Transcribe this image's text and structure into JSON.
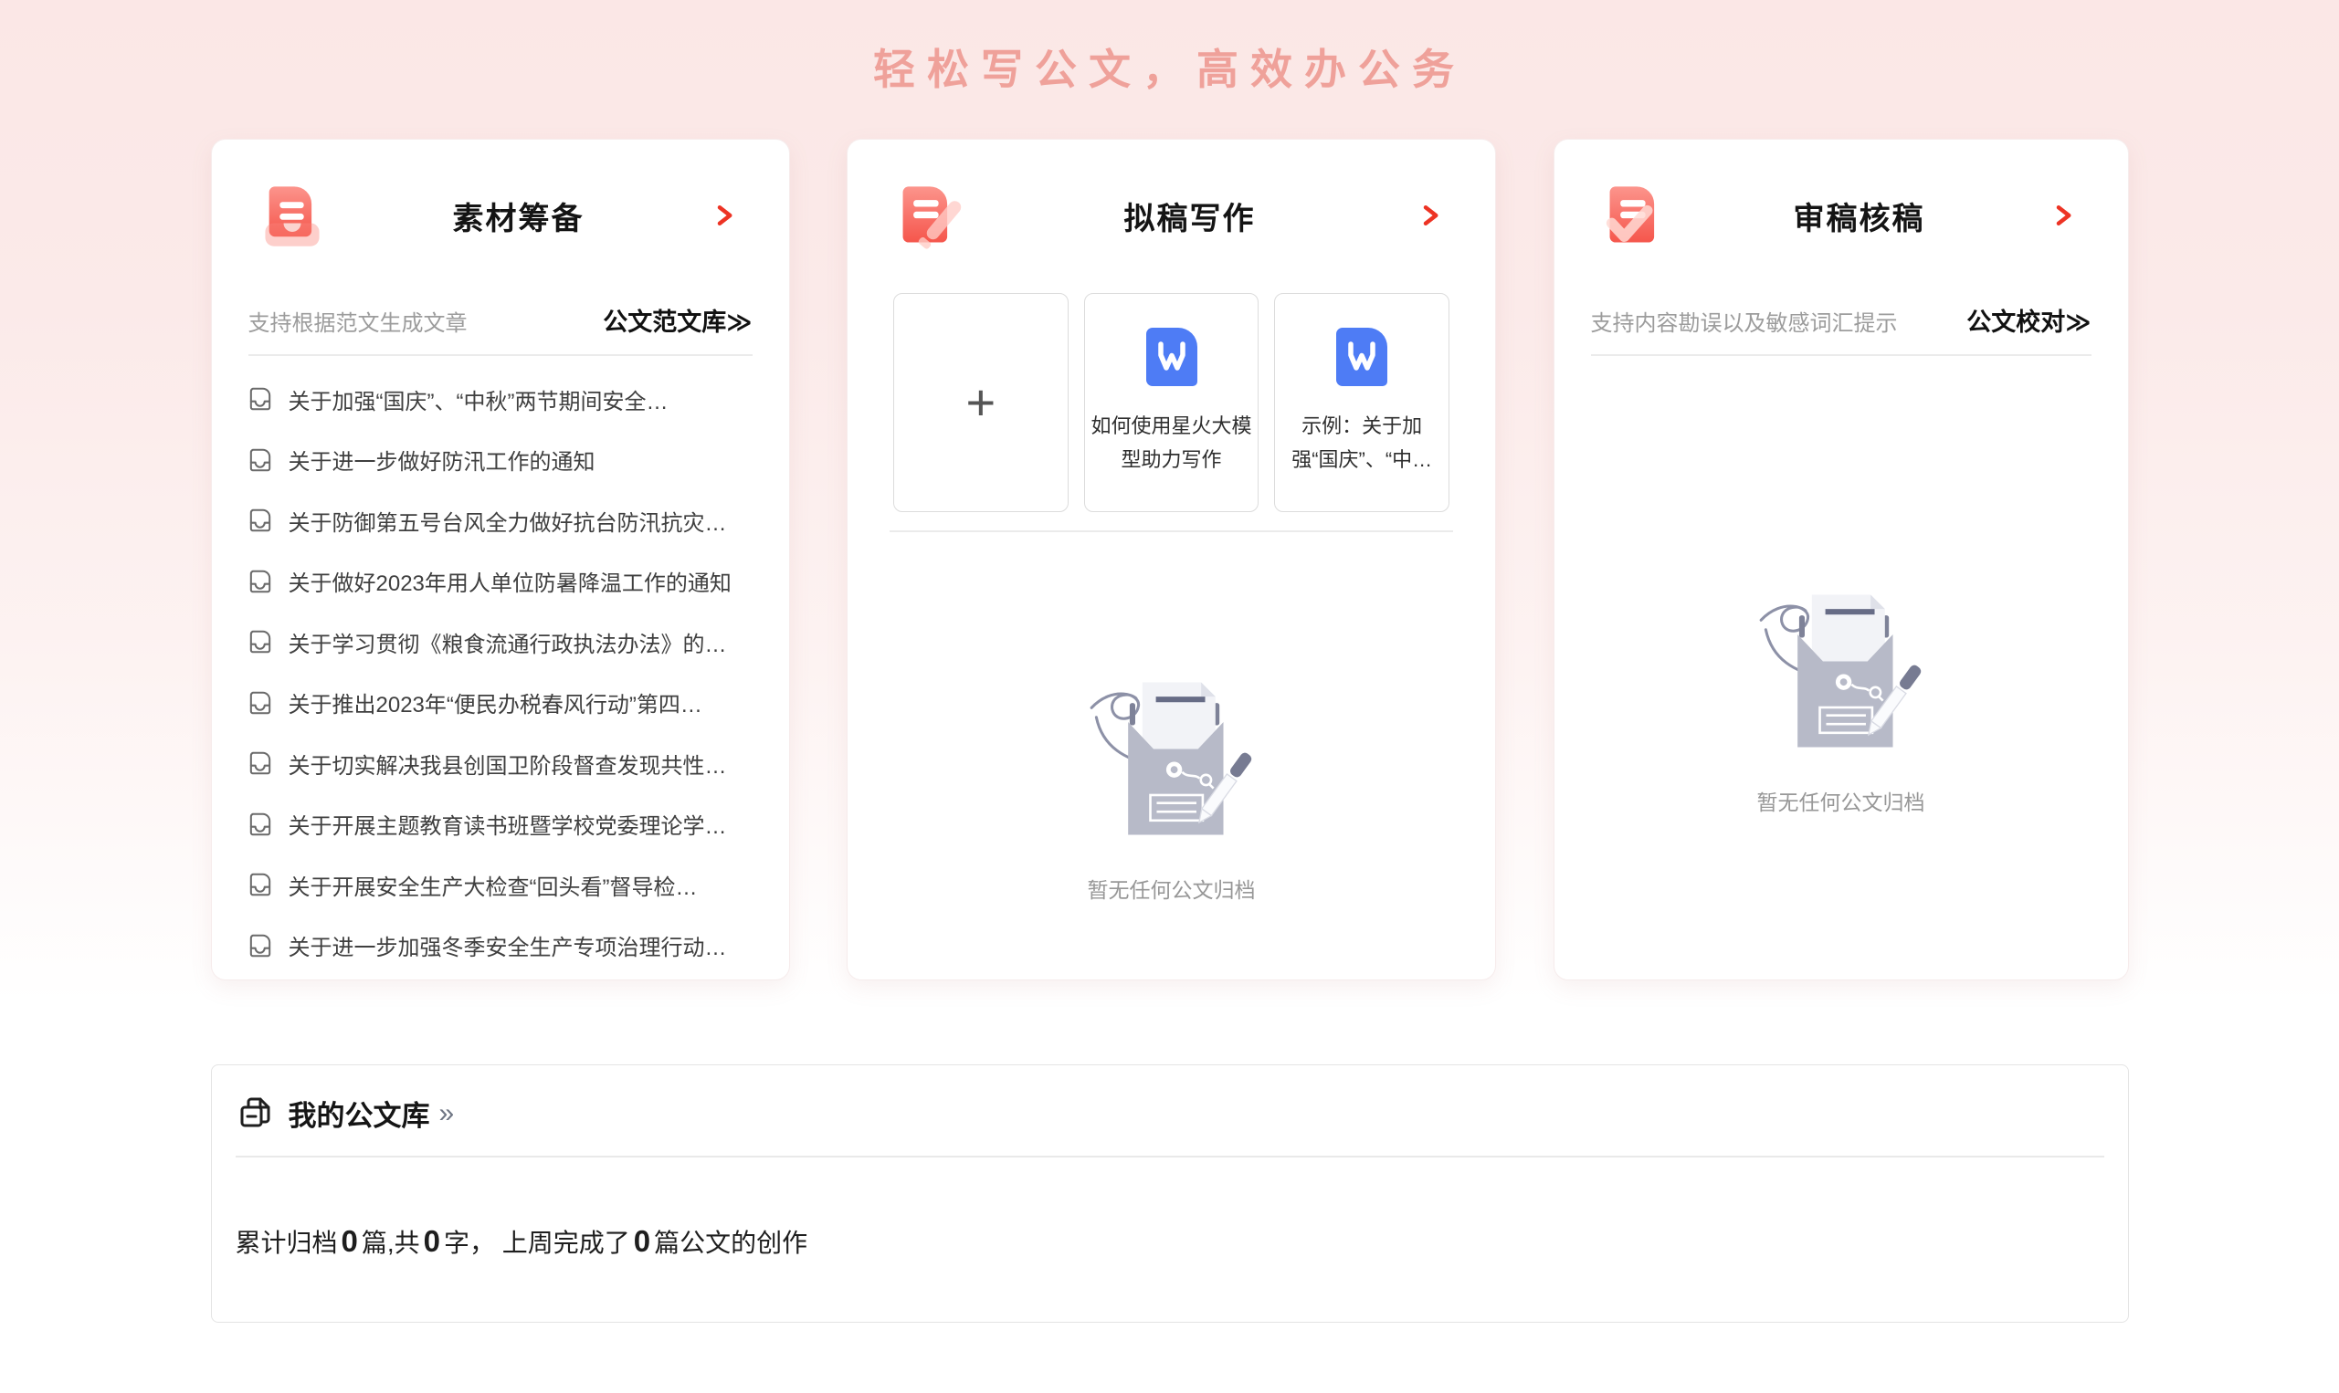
{
  "page": {
    "slogan": "轻松写公文，高效办公务"
  },
  "material_card": {
    "title": "素材筹备",
    "subtitle": "支持根据范文生成文章",
    "link": "公文范文库≫",
    "items": [
      "关于加强“国庆”、“中秋”两节期间安全…",
      "关于进一步做好防汛工作的通知",
      "关于防御第五号台风全力做好抗台防汛抗灾…",
      "关于做好2023年用人单位防暑降温工作的通知",
      "关于学习贯彻《粮食流通行政执法办法》的…",
      "关于推出2023年“便民办税春风行动”第四…",
      "关于切实解决我县创国卫阶段督查发现共性…",
      "关于开展主题教育读书班暨学校党委理论学…",
      "关于开展安全生产大检查“回头看”督导检…",
      "关于进一步加强冬季安全生产专项治理行动…"
    ]
  },
  "draft_card": {
    "title": "拟稿写作",
    "add_label": "+",
    "templates": [
      "如何使用星火大模型助力写作",
      "示例：关于加强“国庆”、“中…"
    ],
    "empty": "暂无任何公文归档"
  },
  "review_card": {
    "title": "审稿核稿",
    "subtitle": "支持内容勘误以及敏感词汇提示",
    "link": "公文校对≫",
    "empty": "暂无任何公文归档"
  },
  "library": {
    "title": "我的公文库",
    "more": "»",
    "stats": {
      "s0": "累计归档",
      "n0": "0",
      "s1": "篇,共",
      "n1": "0",
      "s2": "字， 上周完成了",
      "n2": "0",
      "s3": "篇公文的创作"
    }
  },
  "icons": {
    "material": "document-in-tray-icon",
    "draft": "document-with-pen-icon",
    "review": "document-with-check-icon",
    "template_doc": "blue-word-document-icon",
    "list_item": "archive-document-icon",
    "library": "document-library-icon",
    "arrow": "chevron-right-icon",
    "empty": "empty-folder-illustration"
  },
  "colors": {
    "accent_red": "#ee3a2c",
    "icon_red_light": "#fc948c",
    "icon_red_dark": "#f5564c",
    "doc_blue": "#4e7cf5",
    "slogan_pink": "#efa19a"
  }
}
